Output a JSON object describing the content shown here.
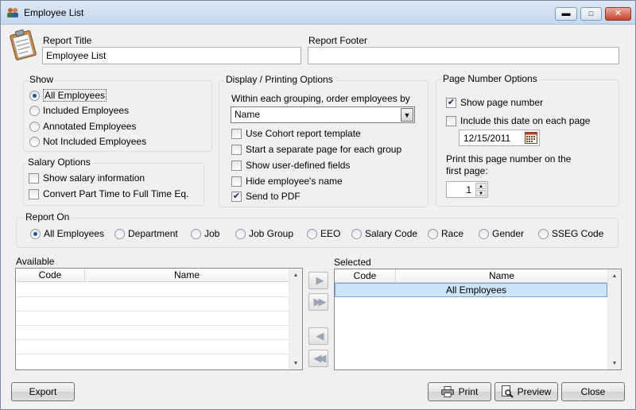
{
  "window": {
    "title": "Employee List",
    "icon": "people-icon"
  },
  "header": {
    "report_title_label": "Report Title",
    "report_title_value": "Employee List",
    "report_footer_label": "Report Footer",
    "report_footer_value": ""
  },
  "show": {
    "label": "Show",
    "options": [
      "All Employees",
      "Included Employees",
      "Annotated Employees",
      "Not Included Employees"
    ],
    "selected": "All Employees"
  },
  "salary_options": {
    "label": "Salary Options",
    "items": [
      {
        "label": "Show salary information",
        "checked": false
      },
      {
        "label": "Convert Part Time to Full Time Eq.",
        "checked": false
      }
    ]
  },
  "display_options": {
    "label": "Display / Printing Options",
    "order_label": "Within each grouping, order employees by",
    "order_value": "Name",
    "items": [
      {
        "label": "Use Cohort report template",
        "checked": false
      },
      {
        "label": "Start a separate page for each group",
        "checked": false
      },
      {
        "label": "Show user-defined fields",
        "checked": false
      },
      {
        "label": "Hide employee's name",
        "checked": false
      },
      {
        "label": "Send to PDF",
        "checked": true
      }
    ]
  },
  "page_number_options": {
    "label": "Page Number Options",
    "show_page_number": {
      "label": "Show page number",
      "checked": true
    },
    "include_date": {
      "label": "Include this date on each page",
      "checked": false
    },
    "date_value": "12/15/2011",
    "first_page_label_1": "Print this page number on the",
    "first_page_label_2": "first page:",
    "first_page_value": "1"
  },
  "report_on": {
    "label": "Report On",
    "options": [
      "All Employees",
      "Department",
      "Job",
      "Job Group",
      "EEO",
      "Salary Code",
      "Race",
      "Gender",
      "SSEG Code"
    ],
    "selected": "All Employees"
  },
  "available": {
    "label": "Available",
    "columns": [
      "Code",
      "Name"
    ],
    "rows": []
  },
  "selected_list": {
    "label": "Selected",
    "columns": [
      "Code",
      "Name"
    ],
    "rows": [
      {
        "code": "",
        "name": "All Employees"
      }
    ]
  },
  "footer": {
    "export_label": "Export",
    "print_label": "Print",
    "preview_label": "Preview",
    "close_label": "Close"
  },
  "colors": {
    "selection": "#cce4f7",
    "accent": "#1d5aa0"
  }
}
